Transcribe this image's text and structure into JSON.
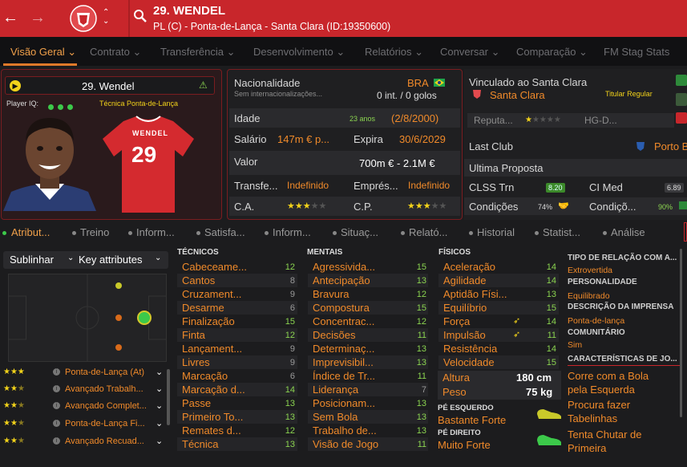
{
  "header": {
    "name": "29. WENDEL",
    "subtitle": "PL (C) - Ponta-de-Lança - Santa Clara (ID:19350600)"
  },
  "tabs": [
    {
      "label": "Visão Geral ⌄",
      "active": true
    },
    {
      "label": "Contrato ⌄"
    },
    {
      "label": "Transferência ⌄"
    },
    {
      "label": "Desenvolvimento ⌄"
    },
    {
      "label": "Relatórios ⌄"
    },
    {
      "label": "Conversar ⌄"
    },
    {
      "label": "Comparação ⌄"
    },
    {
      "label": "FM Stag Stats"
    }
  ],
  "profile": {
    "name": "29. Wendel",
    "player_iq_label": "Player IQ:",
    "role": "Técnica Ponta-de-Lança",
    "shirt_name": "WENDEL",
    "shirt_number": "29"
  },
  "details": {
    "nationality_label": "Nacionalidade",
    "nationality": "BRA",
    "internationals_label": "Sem internacionalizações...",
    "internationals": "0 int. / 0 golos",
    "age_label": "Idade",
    "age_years": "23 anos",
    "age_dob": "(2/8/2000)",
    "salary_label": "Salário",
    "salary": "147m € p...",
    "expires_label": "Expira",
    "expires": "30/6/2029",
    "value_label": "Valor",
    "value": "700m € - 2.1M €",
    "transfer_label": "Transfe...",
    "transfer": "Indefinido",
    "loan_label": "Emprés...",
    "loan": "Indefinido",
    "ca_label": "C.A.",
    "cp_label": "C.P."
  },
  "club": {
    "bound_label": "Vinculado ao Santa Clara",
    "club_name": "Santa Clara",
    "status": "Titular Regular",
    "reputation_label": "Reputa...",
    "hg_label": "HG-D...",
    "last_club_label": "Last Club",
    "last_club": "Porto B",
    "last_offer_label": "Ultima Proposta",
    "clss_label": "CLSS Trn",
    "clss_value": "8.20",
    "cimed_label": "CI Med",
    "cimed_value": "6.89",
    "cond_label": "Condições",
    "cond_value": "74%",
    "cond2_label": "Condiçõ...",
    "cond2_value": "90%"
  },
  "subtabs": [
    {
      "label": "Atribut...",
      "active": true
    },
    {
      "label": "Treino"
    },
    {
      "label": "Inform..."
    },
    {
      "label": "Satisfa..."
    },
    {
      "label": "Inform..."
    },
    {
      "label": "Situaç..."
    },
    {
      "label": "Relató..."
    },
    {
      "label": "Historial"
    },
    {
      "label": "Statist..."
    },
    {
      "label": "Análise"
    }
  ],
  "controls": {
    "highlight": "Sublinhar",
    "key_attr": "Key attributes"
  },
  "positions": [
    {
      "label": "Ponta-de-Lança (At)"
    },
    {
      "label": "Avançado Trabalh..."
    },
    {
      "label": "Avançado Complet..."
    },
    {
      "label": "Ponta-de-Lança Fi..."
    },
    {
      "label": "Avançado Recuad..."
    }
  ],
  "technical": {
    "title": "TÉCNICOS",
    "rows": [
      {
        "name": "Cabeceame...",
        "value": "12",
        "tone": "green"
      },
      {
        "name": "Cantos",
        "value": "8",
        "tone": "grey"
      },
      {
        "name": "Cruzament...",
        "value": "9",
        "tone": "grey"
      },
      {
        "name": "Desarme",
        "value": "6",
        "tone": "grey"
      },
      {
        "name": "Finalização",
        "value": "15",
        "tone": "green"
      },
      {
        "name": "Finta",
        "value": "12",
        "tone": "green"
      },
      {
        "name": "Lançament...",
        "value": "9",
        "tone": "grey"
      },
      {
        "name": "Livres",
        "value": "9",
        "tone": "grey"
      },
      {
        "name": "Marcação",
        "value": "6",
        "tone": "grey"
      },
      {
        "name": "Marcação d...",
        "value": "14",
        "tone": "green"
      },
      {
        "name": "Passe",
        "value": "13",
        "tone": "green"
      },
      {
        "name": "Primeiro To...",
        "value": "13",
        "tone": "green"
      },
      {
        "name": "Remates d...",
        "value": "12",
        "tone": "green"
      },
      {
        "name": "Técnica",
        "value": "13",
        "tone": "green"
      }
    ]
  },
  "mental": {
    "title": "MENTAIS",
    "rows": [
      {
        "name": "Agressivida...",
        "value": "15",
        "tone": "green"
      },
      {
        "name": "Antecipação",
        "value": "13",
        "tone": "green"
      },
      {
        "name": "Bravura",
        "value": "12",
        "tone": "green"
      },
      {
        "name": "Compostura",
        "value": "15",
        "tone": "green"
      },
      {
        "name": "Concentrac...",
        "value": "12",
        "tone": "green"
      },
      {
        "name": "Decisões",
        "value": "11",
        "tone": "green"
      },
      {
        "name": "Determinaç...",
        "value": "13",
        "tone": "green"
      },
      {
        "name": "Imprevisibil...",
        "value": "13",
        "tone": "green"
      },
      {
        "name": "Índice de Tr...",
        "value": "11",
        "tone": "green"
      },
      {
        "name": "Liderança",
        "value": "7",
        "tone": "grey"
      },
      {
        "name": "Posicionam...",
        "value": "13",
        "tone": "green"
      },
      {
        "name": "Sem Bola",
        "value": "13",
        "tone": "green"
      },
      {
        "name": "Trabalho de...",
        "value": "13",
        "tone": "green"
      },
      {
        "name": "Visão de Jogo",
        "value": "11",
        "tone": "green"
      }
    ]
  },
  "physical": {
    "title": "FÍSICOS",
    "rows": [
      {
        "name": "Aceleração",
        "value": "14",
        "tone": "green"
      },
      {
        "name": "Agilidade",
        "value": "14",
        "tone": "green"
      },
      {
        "name": "Aptidão Físi...",
        "value": "13",
        "tone": "green"
      },
      {
        "name": "Equilíbrio",
        "value": "15",
        "tone": "green"
      },
      {
        "name": "Força",
        "value": "14",
        "tone": "green"
      },
      {
        "name": "Impulsão",
        "value": "11",
        "tone": "green"
      },
      {
        "name": "Resistência",
        "value": "14",
        "tone": "green"
      },
      {
        "name": "Velocidade",
        "value": "15",
        "tone": "green"
      }
    ],
    "height_label": "Altura",
    "height": "180 cm",
    "weight_label": "Peso",
    "weight": "75 kg",
    "left_foot_label": "PÉ ESQUERDO",
    "left_foot": "Bastante Forte",
    "right_foot_label": "PÉ DIREITO",
    "right_foot": "Muito Forte"
  },
  "info": {
    "relation_label": "TIPO DE RELAÇÃO COM A...",
    "relation": "Extrovertida",
    "personality_label": "PERSONALIDADE",
    "personality": "Equilibrado",
    "press_label": "DESCRIÇÃO DA IMPRENSA",
    "press": "Ponta-de-lança",
    "community_label": "COMUNITÁRIO",
    "community": "Sim",
    "traits_label": "CARACTERÍSTICAS DE JO...",
    "traits": [
      "Corre com a Bola",
      "pela Esquerda",
      "Procura fazer",
      "Tabelinhas",
      "Tenta Chutar de",
      "Primeira"
    ]
  },
  "colors": {
    "accent": "#c8262b",
    "orange": "#f08a2a",
    "green": "#8bd450"
  }
}
